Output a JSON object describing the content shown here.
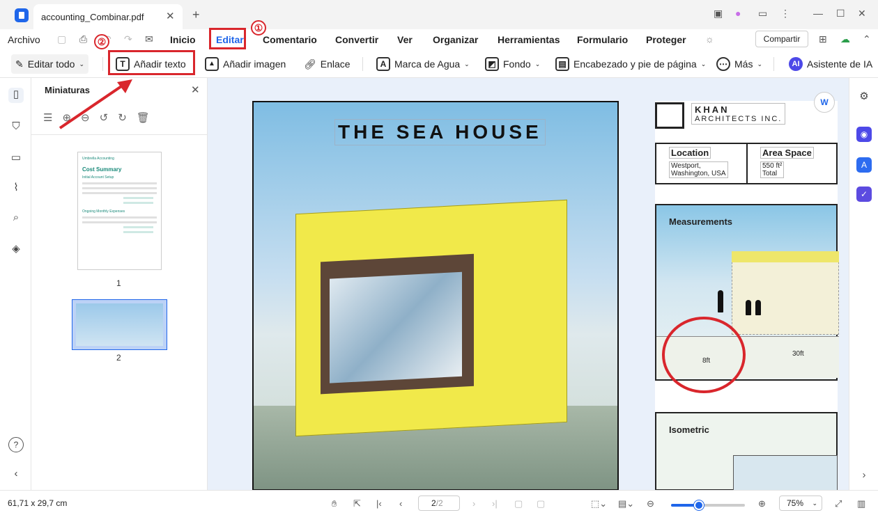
{
  "titlebar": {
    "tab_title": "accounting_Combinar.pdf",
    "icons": [
      "save-icon",
      "print-icon",
      "undo-icon",
      "redo-icon",
      "mail-icon"
    ]
  },
  "menu": {
    "items": [
      "Archivo",
      "Inicio",
      "Editar",
      "Comentario",
      "Convertir",
      "Ver",
      "Organizar",
      "Herramientas",
      "Formulario",
      "Proteger"
    ],
    "active": "Editar",
    "share": "Compartir"
  },
  "toolbar": {
    "edit_all": "Editar todo",
    "add_text": "Añadir texto",
    "add_image": "Añadir imagen",
    "link": "Enlace",
    "watermark": "Marca de Agua",
    "background": "Fondo",
    "header_footer": "Encabezado y pie de página",
    "more": "Más",
    "ai": "Asistente de IA",
    "ai_badge": "AI"
  },
  "thumbnails": {
    "title": "Miniaturas",
    "page1_heading": "Cost Summary",
    "page1_sub1": "Initial Account Setup",
    "page1_sub2": "Ongoing Monthly Expenses",
    "page1_brand": "Umbrella Accounting",
    "pages": [
      "1",
      "2"
    ]
  },
  "document": {
    "poster_title": "THE SEA HOUSE",
    "firm_line1": "KHAN",
    "firm_line2": "ARCHITECTS INC.",
    "location_label": "Location",
    "location_value1": "Westport,",
    "location_value2": "Washington, USA",
    "area_label": "Area Space",
    "area_value1": "550 ft²",
    "area_value2": "Total",
    "measurements": "Measurements",
    "dim_8": "8ft",
    "dim_30": "30ft",
    "isometric": "Isometric"
  },
  "annotations": {
    "step1": "①",
    "step2": "②",
    "color": "#d9262c"
  },
  "status": {
    "dimensions": "61,71 x 29,7 cm",
    "page_current": "2",
    "page_total": "/2",
    "zoom": "75%",
    "zoom_fraction": 0.38
  },
  "colors": {
    "accent": "#1f66ea",
    "annotation": "#d9262c"
  }
}
